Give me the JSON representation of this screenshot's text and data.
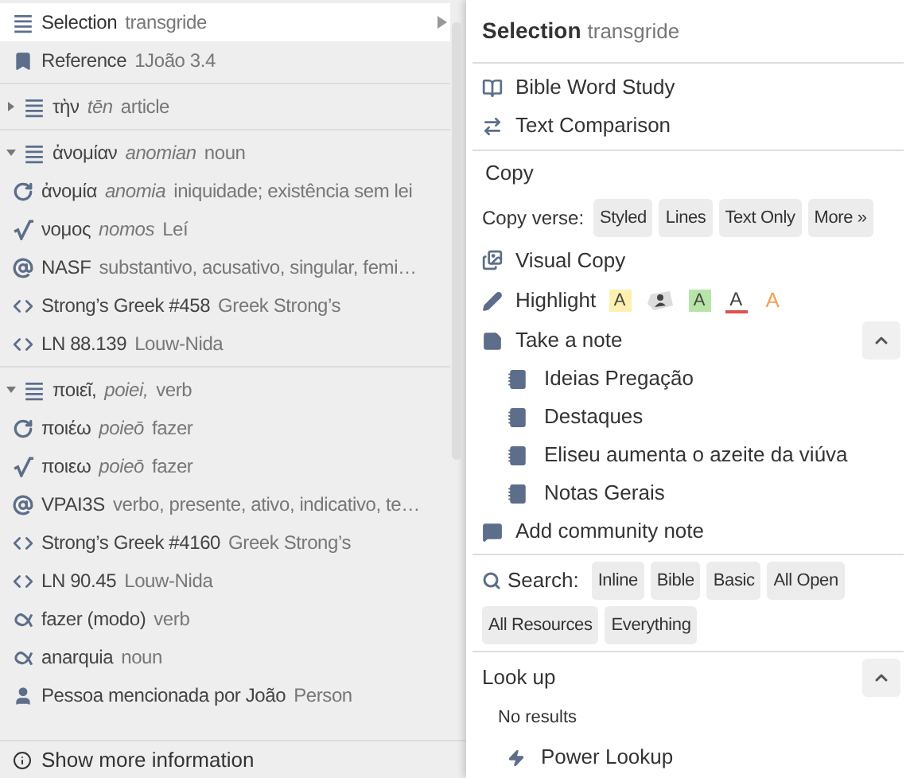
{
  "left_panel": {
    "groups": [
      {
        "items": [
          {
            "kind": "lines",
            "term": "Selection",
            "desc": "transgride",
            "selected": true,
            "submenu": true
          },
          {
            "kind": "bookmark",
            "term": "Reference",
            "desc": "1João 3.4",
            "selected": false
          }
        ]
      },
      {
        "expanded": false,
        "header": {
          "kind": "lines",
          "term": "τὴν",
          "translit": "tēn",
          "desc": "article",
          "selected": false
        }
      },
      {
        "expanded": true,
        "header": {
          "kind": "lines",
          "term": "ἀνομίαν",
          "translit": "anomian",
          "desc": "noun",
          "selected": false
        },
        "items": [
          {
            "kind": "lemma",
            "term": "ἀνομία",
            "translit": "anomia",
            "desc": "iniquidade; existência sem lei",
            "selected": false
          },
          {
            "kind": "root",
            "term": "νομος",
            "translit": "nomos",
            "desc": "Leí",
            "selected": false
          },
          {
            "kind": "morph",
            "term": "NASF",
            "desc": "substantivo, acusativo, singular, femi…",
            "selected": false
          },
          {
            "kind": "code",
            "term": "Strong’s Greek #458",
            "desc": "Greek Strong’s",
            "selected": false
          },
          {
            "kind": "code",
            "term": "LN 88.139",
            "desc": "Louw-Nida",
            "selected": false
          }
        ]
      },
      {
        "expanded": true,
        "header": {
          "kind": "lines",
          "term": "ποιεῖ,",
          "translit": "poiei,",
          "desc": "verb",
          "selected": false
        },
        "items": [
          {
            "kind": "lemma",
            "term": "ποιέω",
            "translit": "poieō",
            "desc": "fazer",
            "selected": false
          },
          {
            "kind": "root",
            "term": "ποιεω",
            "translit": "poieō",
            "desc": "fazer",
            "selected": false
          },
          {
            "kind": "morph",
            "term": "VPAI3S",
            "desc": "verbo, presente, ativo, indicativo, te…",
            "selected": false
          },
          {
            "kind": "code",
            "term": "Strong’s Greek #4160",
            "desc": "Greek Strong’s",
            "selected": false
          },
          {
            "kind": "code",
            "term": "LN 90.45",
            "desc": "Louw-Nida",
            "selected": false
          },
          {
            "kind": "sense",
            "term": "fazer (modo)",
            "desc": "verb",
            "selected": false
          },
          {
            "kind": "sense",
            "term": "anarquia",
            "desc": "noun",
            "selected": false
          },
          {
            "kind": "person",
            "term": "Pessoa mencionada por João",
            "desc": "Person",
            "selected": false
          }
        ]
      }
    ],
    "footer": "Show more information"
  },
  "right_panel": {
    "title": "Selection",
    "subtitle": "transgride",
    "tools": [
      {
        "kind": "study",
        "label": "Bible Word Study"
      },
      {
        "kind": "compare",
        "label": "Text Comparison"
      }
    ],
    "copy": {
      "heading": "Copy",
      "verse_label": "Copy verse:",
      "verse_buttons": [
        "Styled",
        "Lines",
        "Text Only",
        "More »"
      ],
      "visual_copy": "Visual Copy"
    },
    "highlight": {
      "label": "Highlight",
      "styles": [
        {
          "kind": "fill",
          "text": "A",
          "color": "#fdf0b0"
        },
        {
          "kind": "tag"
        },
        {
          "kind": "fill",
          "text": "A",
          "color": "#b8e4a8"
        },
        {
          "kind": "underline",
          "text": "A",
          "color": "#e05050"
        },
        {
          "kind": "font",
          "text": "A",
          "color": "#f5a050"
        }
      ]
    },
    "notes": {
      "label": "Take a note",
      "expanded": true,
      "notebooks": [
        "Ideias Pregação",
        "Destaques",
        "Eliseu aumenta o azeite da viúva",
        "Notas Gerais"
      ],
      "community": "Add community note"
    },
    "search": {
      "label": "Search:",
      "buttons": [
        "Inline",
        "Bible",
        "Basic",
        "All Open",
        "All Resources",
        "Everything"
      ]
    },
    "lookup": {
      "heading": "Look up",
      "expanded": true,
      "status": "No results",
      "items": [
        "Power Lookup"
      ]
    }
  }
}
